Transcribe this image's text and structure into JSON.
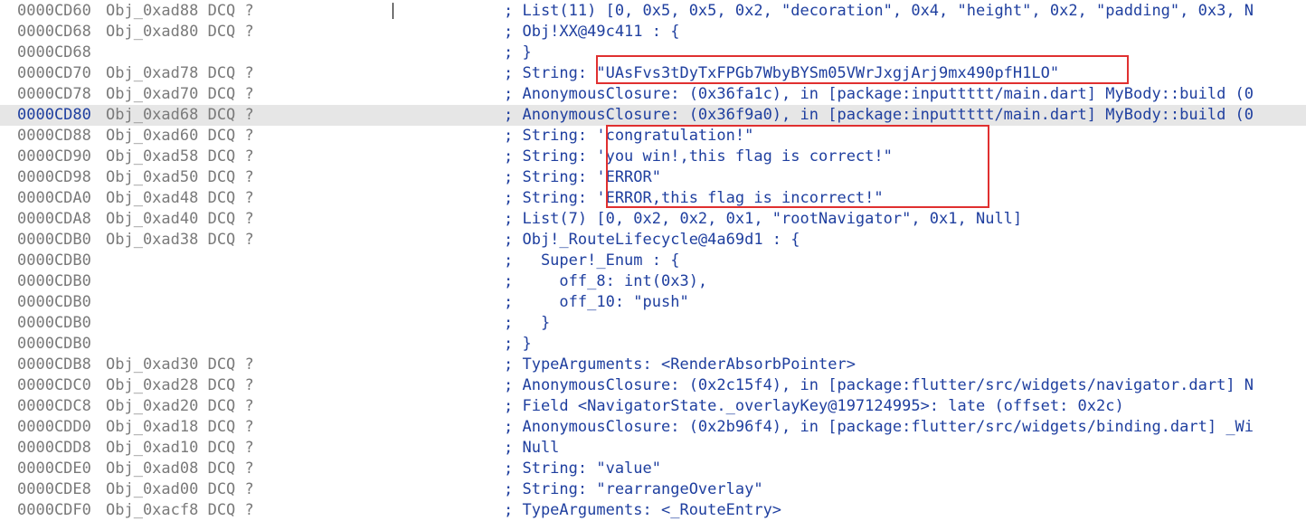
{
  "colors": {
    "address": "#7a7a7a",
    "selected_address": "#1f3f9f",
    "comment": "#1f3f9f",
    "selection_background": "#e6e6e6",
    "highlight_box": "#e03030"
  },
  "listing": {
    "selected_index": 5,
    "rows": [
      {
        "addr": "0000CD60",
        "name": "Obj_0xad88 DCQ ?",
        "comment": "; List(11) [0, 0x5, 0x5, 0x2, \"decoration\", 0x4, \"height\", 0x2, \"padding\", 0x3, N"
      },
      {
        "addr": "0000CD68",
        "name": "Obj_0xad80 DCQ ?",
        "comment": "; Obj!XX@49c411 : {"
      },
      {
        "addr": "0000CD68",
        "name": "",
        "comment": "; }"
      },
      {
        "addr": "0000CD70",
        "name": "Obj_0xad78 DCQ ?",
        "comment": "; String: \"UAsFvs3tDyTxFPGb7WbyBYSm05VWrJxgjArj9mx490pfH1LO\""
      },
      {
        "addr": "0000CD78",
        "name": "Obj_0xad70 DCQ ?",
        "comment": "; AnonymousClosure: (0x36fa1c), in [package:inputtttt/main.dart] MyBody::build (0"
      },
      {
        "addr": "0000CD80",
        "name": "Obj_0xad68 DCQ ?",
        "comment": "; AnonymousClosure: (0x36f9a0), in [package:inputtttt/main.dart] MyBody::build (0"
      },
      {
        "addr": "0000CD88",
        "name": "Obj_0xad60 DCQ ?",
        "comment": "; String: 'congratulation!\""
      },
      {
        "addr": "0000CD90",
        "name": "Obj_0xad58 DCQ ?",
        "comment": "; String: 'you win!,this flag is correct!\""
      },
      {
        "addr": "0000CD98",
        "name": "Obj_0xad50 DCQ ?",
        "comment": "; String: 'ERROR\""
      },
      {
        "addr": "0000CDA0",
        "name": "Obj_0xad48 DCQ ?",
        "comment": "; String: 'ERROR,this flag is incorrect!\""
      },
      {
        "addr": "0000CDA8",
        "name": "Obj_0xad40 DCQ ?",
        "comment": "; List(7) [0, 0x2, 0x2, 0x1, \"rootNavigator\", 0x1, Null]"
      },
      {
        "addr": "0000CDB0",
        "name": "Obj_0xad38 DCQ ?",
        "comment": "; Obj!_RouteLifecycle@4a69d1 : {"
      },
      {
        "addr": "0000CDB0",
        "name": "",
        "comment": ";   Super!_Enum : {"
      },
      {
        "addr": "0000CDB0",
        "name": "",
        "comment": ";     off_8: int(0x3),"
      },
      {
        "addr": "0000CDB0",
        "name": "",
        "comment": ";     off_10: \"push\""
      },
      {
        "addr": "0000CDB0",
        "name": "",
        "comment": ";   }"
      },
      {
        "addr": "0000CDB0",
        "name": "",
        "comment": "; }"
      },
      {
        "addr": "0000CDB8",
        "name": "Obj_0xad30 DCQ ?",
        "comment": "; TypeArguments: <RenderAbsorbPointer>"
      },
      {
        "addr": "0000CDC0",
        "name": "Obj_0xad28 DCQ ?",
        "comment": "; AnonymousClosure: (0x2c15f4), in [package:flutter/src/widgets/navigator.dart] N"
      },
      {
        "addr": "0000CDC8",
        "name": "Obj_0xad20 DCQ ?",
        "comment": "; Field <NavigatorState._overlayKey@197124995>: late (offset: 0x2c)"
      },
      {
        "addr": "0000CDD0",
        "name": "Obj_0xad18 DCQ ?",
        "comment": "; AnonymousClosure: (0x2b96f4), in [package:flutter/src/widgets/binding.dart] _Wi"
      },
      {
        "addr": "0000CDD8",
        "name": "Obj_0xad10 DCQ ?",
        "comment": "; Null"
      },
      {
        "addr": "0000CDE0",
        "name": "Obj_0xad08 DCQ ?",
        "comment": "; String: \"value\""
      },
      {
        "addr": "0000CDE8",
        "name": "Obj_0xad00 DCQ ?",
        "comment": "; String: \"rearrangeOverlay\""
      },
      {
        "addr": "0000CDF0",
        "name": "Obj_0xacf8 DCQ ?",
        "comment": "; TypeArguments: <_RouteEntry>"
      }
    ]
  }
}
